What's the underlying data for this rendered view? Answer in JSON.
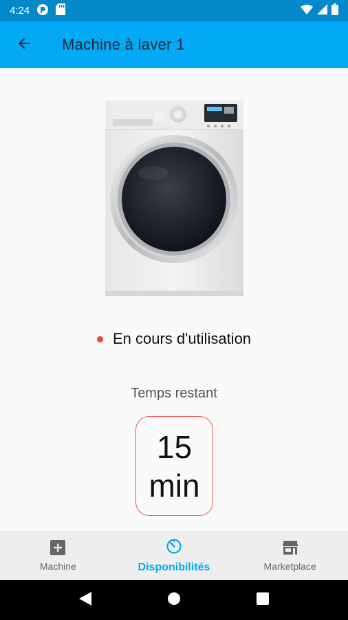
{
  "status_bar": {
    "time": "4:24"
  },
  "app_bar": {
    "title": "Machine à laver 1"
  },
  "machine": {
    "state_text": "En cours d'utilisation",
    "state_color": "#f44336",
    "remaining_label": "Temps restant",
    "remaining_value": "15",
    "remaining_unit": "min"
  },
  "bottom_nav": {
    "items": [
      {
        "label": "Machine",
        "icon": "add-box-icon",
        "active": false
      },
      {
        "label": "Disponibilités",
        "icon": "timer-icon",
        "active": true
      },
      {
        "label": "Marketplace",
        "icon": "store-icon",
        "active": false
      }
    ]
  },
  "colors": {
    "primary": "#03a9f4",
    "status_bar": "#0388c9",
    "accent_red": "#ef5350"
  }
}
